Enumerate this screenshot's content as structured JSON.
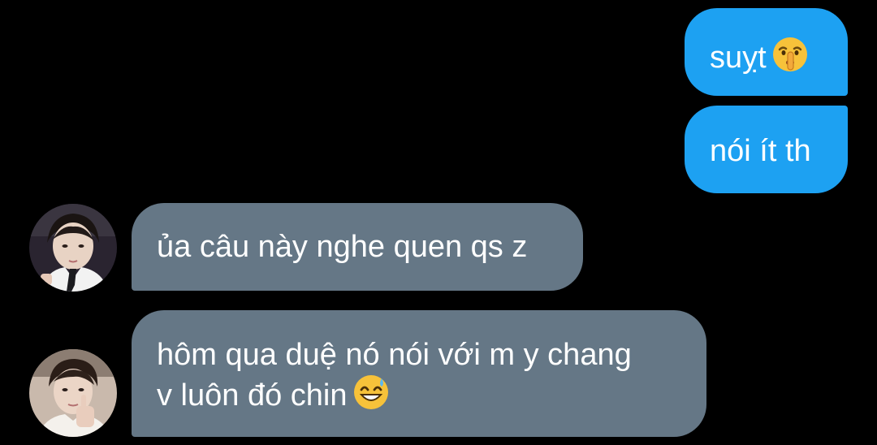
{
  "messages": [
    {
      "direction": "sent",
      "text": "suỵt",
      "emoji": "shushing-face-emoji"
    },
    {
      "direction": "sent",
      "text": "nói ít th"
    },
    {
      "direction": "received",
      "text": "ủa câu này nghe quen qs z",
      "avatar": "user-avatar-photo"
    },
    {
      "direction": "received",
      "lines": [
        "hôm qua duệ nó nói với m y chang",
        "v luôn đó chin"
      ],
      "emoji": "grinning-face-with-sweat-emoji",
      "avatar": "user-avatar-photo"
    }
  ],
  "colors": {
    "background": "#000000",
    "sent_bubble": "#1da1f2",
    "received_bubble": "#657786",
    "text": "#ffffff"
  }
}
